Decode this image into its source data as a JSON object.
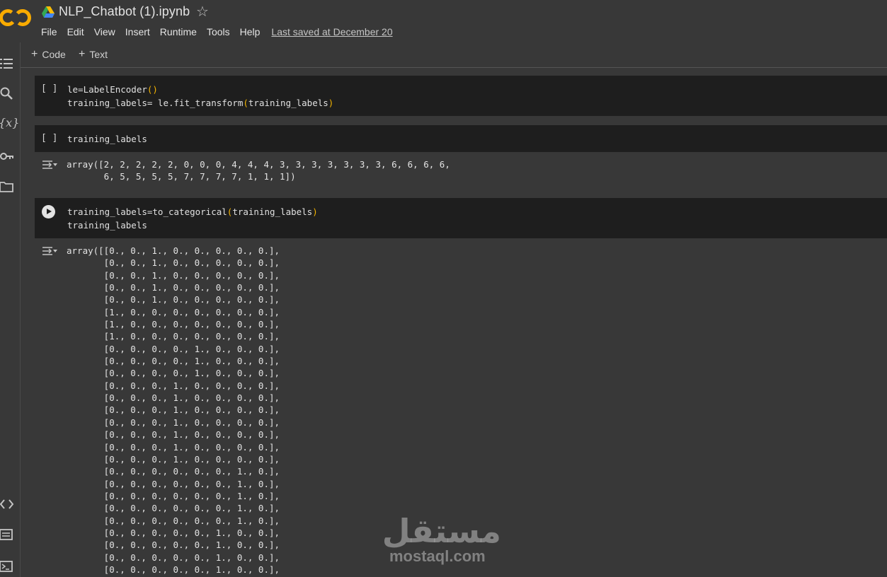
{
  "header": {
    "title": "NLP_Chatbot (1).ipynb",
    "logo_text": "CO",
    "menu": [
      "File",
      "Edit",
      "View",
      "Insert",
      "Runtime",
      "Tools",
      "Help"
    ],
    "last_saved": "Last saved at December 20"
  },
  "toolbar": {
    "add_code_label": "Code",
    "add_text_label": "Text"
  },
  "cells": [
    {
      "prompt": "[ ]",
      "code_line1_a": "le=LabelEncoder",
      "code_line1_b": "()",
      "code_line2_a": "training_labels= le.fit_transform",
      "code_line2_b": "(",
      "code_line2_c": "training_labels",
      "code_line2_d": ")"
    },
    {
      "prompt": "[ ]",
      "code": "training_labels",
      "output": "array([2, 2, 2, 2, 2, 0, 0, 0, 4, 4, 4, 3, 3, 3, 3, 3, 3, 3, 6, 6, 6, 6,\n       6, 5, 5, 5, 5, 7, 7, 7, 7, 1, 1, 1])"
    },
    {
      "code_line1_a": "training_labels=to_categorical",
      "code_line1_b": "(",
      "code_line1_c": "training_labels",
      "code_line1_d": ")",
      "code_line2": "training_labels",
      "output": "array([[0., 0., 1., 0., 0., 0., 0., 0.],\n       [0., 0., 1., 0., 0., 0., 0., 0.],\n       [0., 0., 1., 0., 0., 0., 0., 0.],\n       [0., 0., 1., 0., 0., 0., 0., 0.],\n       [0., 0., 1., 0., 0., 0., 0., 0.],\n       [1., 0., 0., 0., 0., 0., 0., 0.],\n       [1., 0., 0., 0., 0., 0., 0., 0.],\n       [1., 0., 0., 0., 0., 0., 0., 0.],\n       [0., 0., 0., 0., 1., 0., 0., 0.],\n       [0., 0., 0., 0., 1., 0., 0., 0.],\n       [0., 0., 0., 0., 1., 0., 0., 0.],\n       [0., 0., 0., 1., 0., 0., 0., 0.],\n       [0., 0., 0., 1., 0., 0., 0., 0.],\n       [0., 0., 0., 1., 0., 0., 0., 0.],\n       [0., 0., 0., 1., 0., 0., 0., 0.],\n       [0., 0., 0., 1., 0., 0., 0., 0.],\n       [0., 0., 0., 1., 0., 0., 0., 0.],\n       [0., 0., 0., 1., 0., 0., 0., 0.],\n       [0., 0., 0., 0., 0., 0., 1., 0.],\n       [0., 0., 0., 0., 0., 0., 1., 0.],\n       [0., 0., 0., 0., 0., 0., 1., 0.],\n       [0., 0., 0., 0., 0., 0., 1., 0.],\n       [0., 0., 0., 0., 0., 0., 1., 0.],\n       [0., 0., 0., 0., 0., 1., 0., 0.],\n       [0., 0., 0., 0., 0., 1., 0., 0.],\n       [0., 0., 0., 0., 0., 1., 0., 0.],\n       [0., 0., 0., 0., 0., 1., 0., 0.],"
    }
  ],
  "watermark": {
    "arabic": "مستقل",
    "latin": "mostaql.com"
  },
  "colors": {
    "background": "#383838",
    "cell_background": "#1e1e1e",
    "paren_accent": "#f4b400",
    "logo_orange": "#f9ab00"
  },
  "rail_icons": [
    "table-of-contents-icon",
    "search-icon",
    "variables-icon",
    "secrets-key-icon",
    "files-folder-icon",
    "code-snippets-icon",
    "command-palette-icon",
    "terminal-icon"
  ]
}
